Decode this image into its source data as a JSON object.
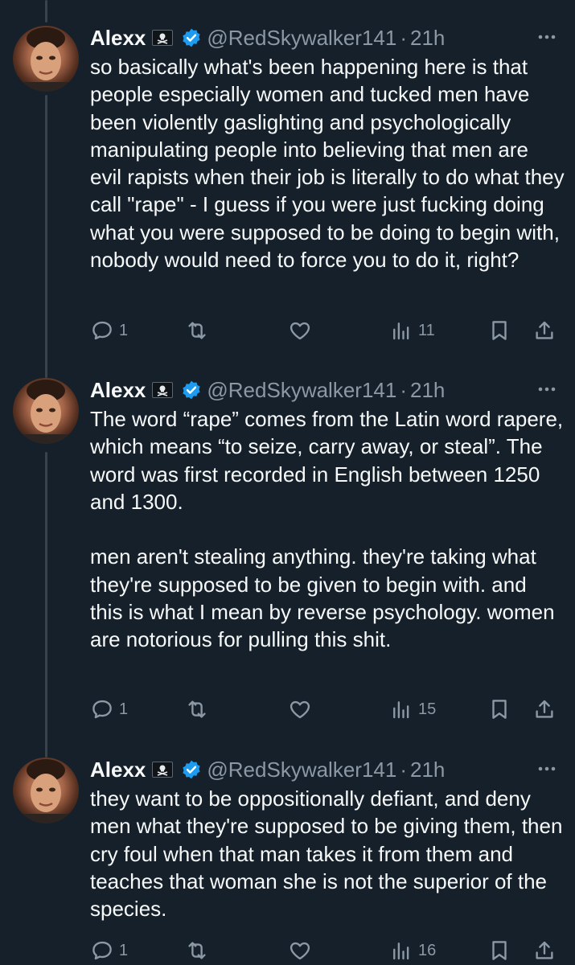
{
  "tweets": [
    {
      "author": {
        "name": "Alexx",
        "handle": "@RedSkywalker141",
        "flag_icon": "pirate-flag-icon",
        "verified_icon": "verified-badge-icon",
        "verified_color": "#1d9bf0"
      },
      "separator": "·",
      "time": "21h",
      "text": "so basically what's been happening here is that people especially women and tucked men have been violently gaslighting and psychologically manipulating people into believing that men are evil rapists when their job is literally to do what they call \"rape\" - I guess if you were just fucking doing what you were supposed to be doing to begin with, nobody would need to force you to do it, right?",
      "stats": {
        "replies": "1",
        "retweets": "",
        "likes": "",
        "views": "11"
      }
    },
    {
      "author": {
        "name": "Alexx",
        "handle": "@RedSkywalker141",
        "flag_icon": "pirate-flag-icon",
        "verified_icon": "verified-badge-icon",
        "verified_color": "#1d9bf0"
      },
      "separator": "·",
      "time": "21h",
      "text": "The word “rape” comes from the Latin word rapere, which means “to seize, carry away, or steal”. The word was first recorded in English between 1250 and 1300.\n\nmen aren't stealing anything. they're taking what they're supposed to be given to begin with. and this is what I mean by reverse psychology. women are notorious for pulling this shit.",
      "stats": {
        "replies": "1",
        "retweets": "",
        "likes": "",
        "views": "15"
      }
    },
    {
      "author": {
        "name": "Alexx",
        "handle": "@RedSkywalker141",
        "flag_icon": "pirate-flag-icon",
        "verified_icon": "verified-badge-icon",
        "verified_color": "#1d9bf0"
      },
      "separator": "·",
      "time": "21h",
      "text": "they want to be oppositionally defiant, and deny men what they're supposed to be giving them, then cry foul when that man takes it from them and teaches that woman she is not the superior of the species.",
      "stats": {
        "replies": "1",
        "retweets": "",
        "likes": "",
        "views": "16"
      }
    }
  ],
  "theme": {
    "background": "#15202b",
    "text": "#f7f9f9",
    "secondary_text": "#8b98a5",
    "thread_line": "#38444d"
  }
}
